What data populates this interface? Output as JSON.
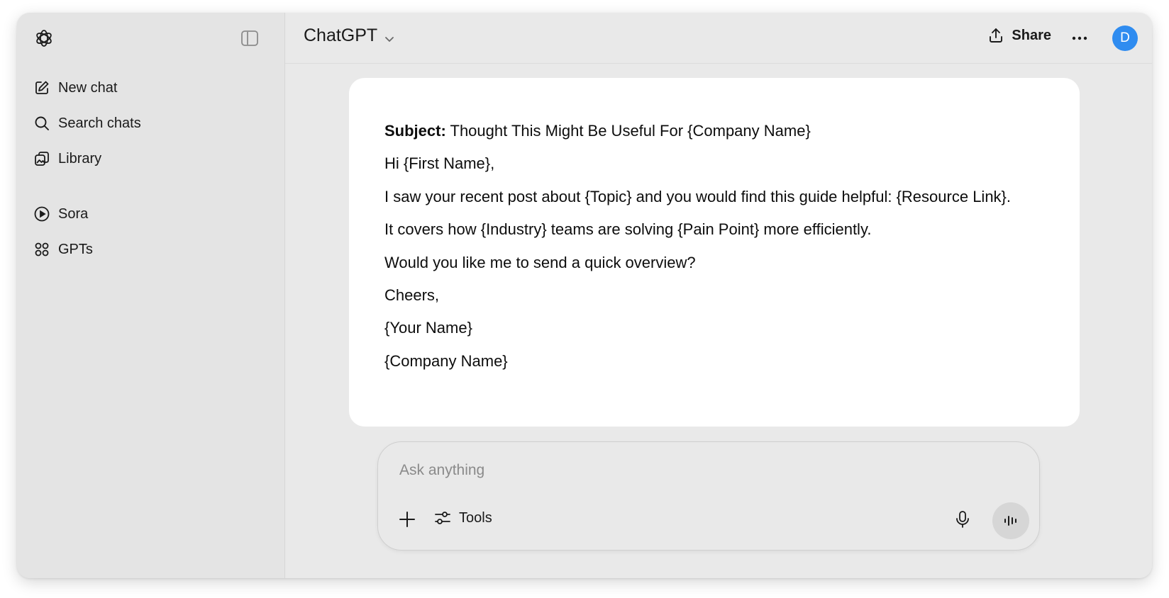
{
  "sidebar": {
    "items": [
      {
        "label": "New chat",
        "icon": "edit-icon"
      },
      {
        "label": "Search chats",
        "icon": "search-icon"
      },
      {
        "label": "Library",
        "icon": "library-icon"
      },
      {
        "label": "Sora",
        "icon": "play-circle-icon"
      },
      {
        "label": "GPTs",
        "icon": "grid-icon"
      }
    ]
  },
  "header": {
    "model": "ChatGPT",
    "share_label": "Share",
    "avatar_initial": "D"
  },
  "message": {
    "subject_label": "Subject:",
    "subject_text": " Thought This Might Be Useful For {Company Name}",
    "lines": [
      "Hi {First Name},",
      "I saw your recent post about {Topic} and you would find this guide helpful: {Resource Link}.",
      "It covers how {Industry} teams are solving {Pain Point} more efficiently.",
      "Would you like me to send a quick overview?",
      "Cheers,",
      "{Your Name}",
      "{Company Name}"
    ]
  },
  "composer": {
    "placeholder": "Ask anything",
    "value": "",
    "tools_label": "Tools"
  },
  "colors": {
    "avatar_bg": "#2f8cf0",
    "window_bg": "#e9e9e9",
    "sidebar_bg": "#e4e4e4"
  }
}
